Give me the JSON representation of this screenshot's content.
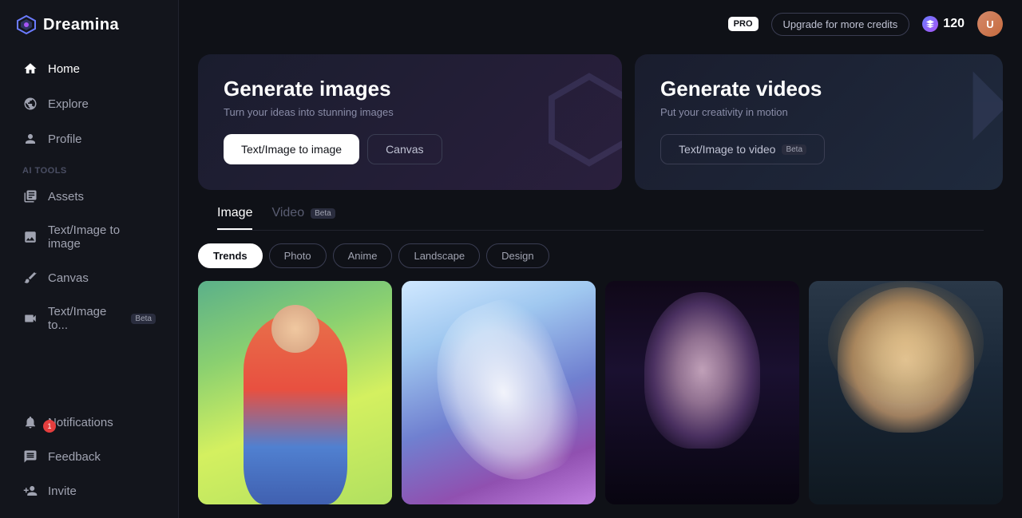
{
  "app": {
    "name": "Dreamina",
    "logo_text": "Dreamina"
  },
  "topbar": {
    "pro_label": "PRO",
    "upgrade_label": "Upgrade for more credits",
    "credits": "120"
  },
  "sidebar": {
    "nav_items": [
      {
        "id": "home",
        "label": "Home",
        "icon": "home-icon",
        "active": true
      },
      {
        "id": "explore",
        "label": "Explore",
        "icon": "explore-icon"
      },
      {
        "id": "profile",
        "label": "Profile",
        "icon": "profile-icon"
      }
    ],
    "ai_tools_label": "AI tools",
    "tool_items": [
      {
        "id": "assets",
        "label": "Assets",
        "icon": "assets-icon"
      },
      {
        "id": "text-image",
        "label": "Text/Image to image",
        "icon": "text-image-icon"
      },
      {
        "id": "canvas",
        "label": "Canvas",
        "icon": "canvas-icon"
      },
      {
        "id": "text-video",
        "label": "Text/Image to...",
        "icon": "text-video-icon",
        "badge": "Beta"
      }
    ],
    "bottom_items": [
      {
        "id": "notifications",
        "label": "Notifications",
        "icon": "bell-icon",
        "badge_count": "1"
      },
      {
        "id": "feedback",
        "label": "Feedback",
        "icon": "feedback-icon"
      },
      {
        "id": "invite",
        "label": "Invite",
        "icon": "invite-icon"
      }
    ]
  },
  "hero": {
    "images_card": {
      "title": "Generate images",
      "subtitle": "Turn your ideas into stunning images",
      "btn1": "Text/Image to image",
      "btn2": "Canvas"
    },
    "videos_card": {
      "title": "Generate videos",
      "subtitle": "Put your creativity in motion",
      "btn1": "Text/Image to video",
      "btn1_badge": "Beta"
    }
  },
  "tabs": [
    {
      "id": "image",
      "label": "Image",
      "active": true
    },
    {
      "id": "video",
      "label": "Video",
      "badge": "Beta"
    }
  ],
  "filters": [
    {
      "id": "trends",
      "label": "Trends",
      "active": true
    },
    {
      "id": "photo",
      "label": "Photo"
    },
    {
      "id": "anime",
      "label": "Anime"
    },
    {
      "id": "landscape",
      "label": "Landscape"
    },
    {
      "id": "design",
      "label": "Design"
    }
  ],
  "images": [
    {
      "id": "img1",
      "style": "doll",
      "alt": "3D doll character in red coat"
    },
    {
      "id": "img2",
      "style": "unicorn",
      "alt": "Rainbow unicorn"
    },
    {
      "id": "img3",
      "style": "warrior",
      "alt": "Dark warrior woman"
    },
    {
      "id": "img4",
      "style": "portrait",
      "alt": "Blonde portrait"
    }
  ]
}
